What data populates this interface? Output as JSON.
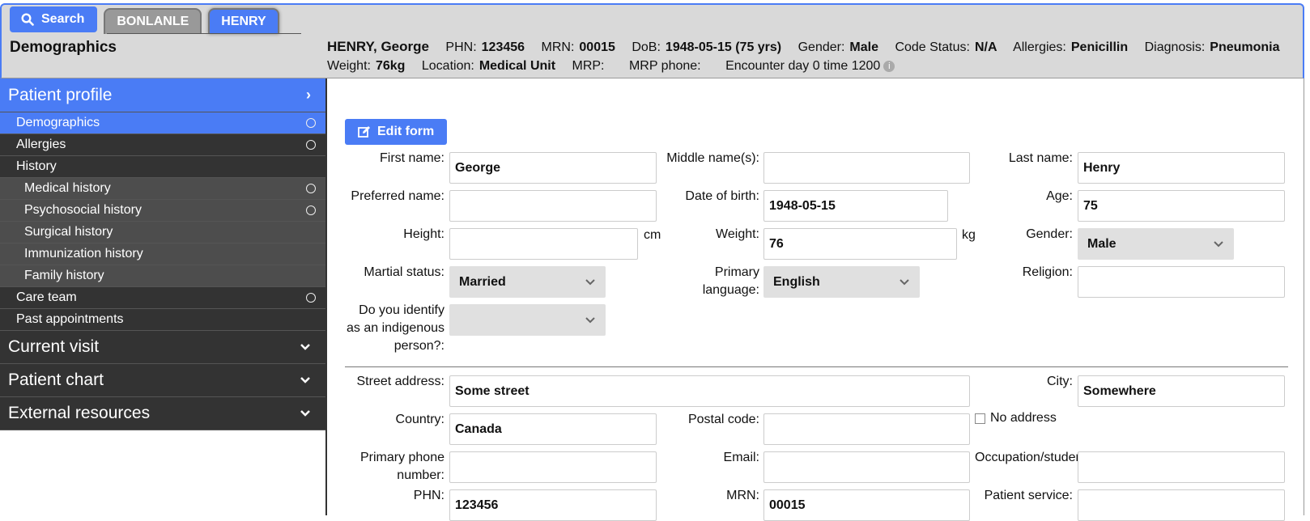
{
  "header": {
    "search_label": "Search",
    "tabs": [
      {
        "label": "BONLANLE",
        "active": false
      },
      {
        "label": "HENRY",
        "active": true
      }
    ],
    "page_title": "Demographics",
    "patient": {
      "name": "HENRY, George",
      "phn_label": "PHN:",
      "phn": "123456",
      "mrn_label": "MRN:",
      "mrn": "00015",
      "dob_label": "DoB:",
      "dob": "1948-05-15 (75 yrs)",
      "gender_label": "Gender:",
      "gender": "Male",
      "code_status_label": "Code Status:",
      "code_status": "N/A",
      "allergies_label": "Allergies:",
      "allergies": "Penicillin",
      "diagnosis_label": "Diagnosis:",
      "diagnosis": "Pneumonia",
      "weight_label": "Weight:",
      "weight": "76kg",
      "location_label": "Location:",
      "location": "Medical Unit",
      "mrp_label": "MRP:",
      "mrp_phone_label": "MRP phone:",
      "encounter": "Encounter day 0 time 1200"
    }
  },
  "sidebar": {
    "patient_profile": "Patient profile",
    "items": [
      {
        "label": "Demographics",
        "circle": true
      },
      {
        "label": "Allergies",
        "circle": true
      },
      {
        "label": "History",
        "circle": false
      },
      {
        "label": "Medical history",
        "circle": true
      },
      {
        "label": "Psychosocial history",
        "circle": true
      },
      {
        "label": "Surgical history",
        "circle": false
      },
      {
        "label": "Immunization history",
        "circle": false
      },
      {
        "label": "Family history",
        "circle": false
      },
      {
        "label": "Care team",
        "circle": true
      },
      {
        "label": "Past appointments",
        "circle": false
      }
    ],
    "current_visit": "Current visit",
    "patient_chart": "Patient chart",
    "external_resources": "External resources"
  },
  "form": {
    "edit_label": "Edit form",
    "first_name_label": "First name:",
    "first_name": "George",
    "middle_name_label": "Middle name(s):",
    "middle_name": "",
    "last_name_label": "Last name:",
    "last_name": "Henry",
    "preferred_name_label": "Preferred name:",
    "preferred_name": "",
    "dob_label": "Date of birth:",
    "dob": "1948-05-15",
    "age_label": "Age:",
    "age": "75",
    "height_label": "Height:",
    "height": "",
    "height_unit": "cm",
    "weight_label": "Weight:",
    "weight": "76",
    "weight_unit": "kg",
    "gender_label": "Gender:",
    "gender": "Male",
    "marital_label": "Martial status:",
    "marital": "Married",
    "language_label_1": "Primary",
    "language_label_2": "language:",
    "language": "English",
    "religion_label": "Religion:",
    "religion": "",
    "indigenous_label_1": "Do you identify",
    "indigenous_label_2": "as an indigenous",
    "indigenous_label_3": "person?:",
    "indigenous": "",
    "street_label": "Street address:",
    "street": "Some street",
    "city_label": "City:",
    "city": "Somewhere",
    "country_label": "Country:",
    "country": "Canada",
    "postal_label": "Postal code:",
    "postal": "",
    "no_address_label": "No address",
    "phone_label_1": "Primary phone",
    "phone_label_2": "number:",
    "phone": "",
    "email_label": "Email:",
    "email": "",
    "occupation_label": "Occupation/student:",
    "occupation": "",
    "phn_label": "PHN:",
    "phn": "123456",
    "mrn_label": "MRN:",
    "mrn": "00015",
    "service_label": "Patient service:",
    "service": ""
  },
  "colors": {
    "accent": "#4a7cf5",
    "sidebar_dark": "#333333",
    "header_bg": "#d9d9d9"
  }
}
